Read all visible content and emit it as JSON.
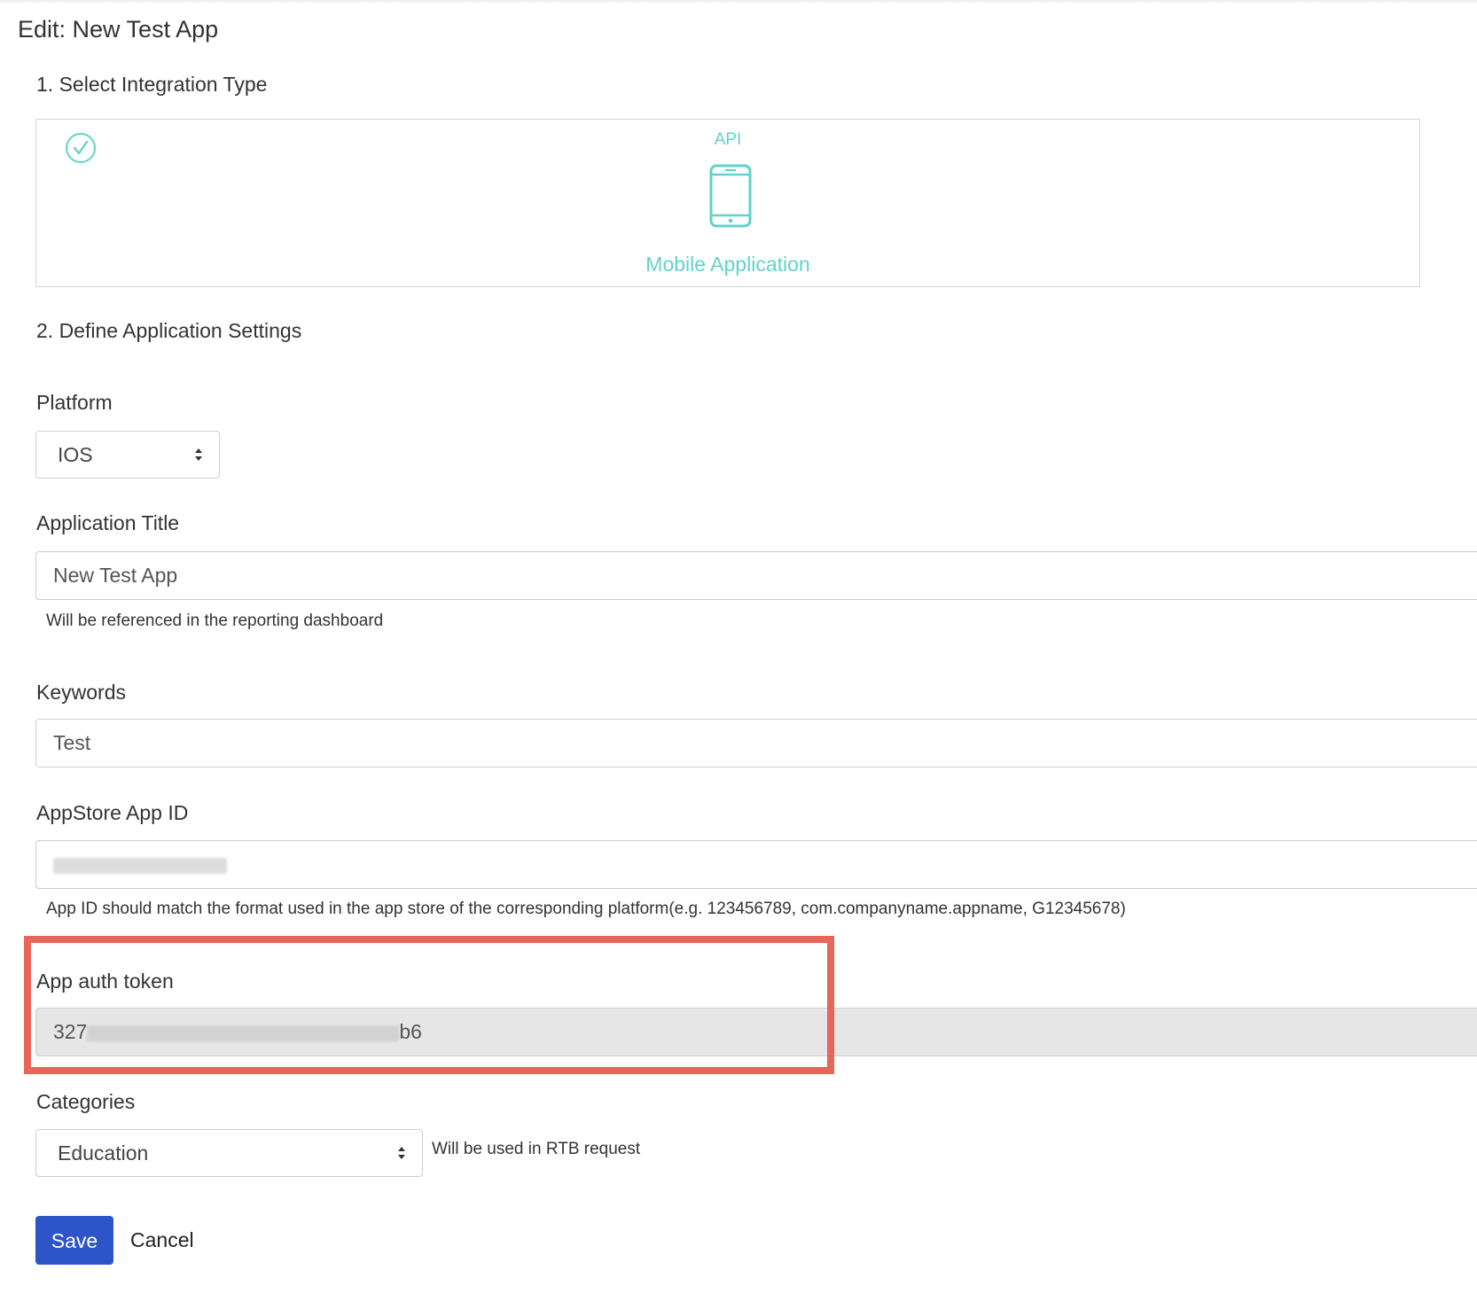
{
  "page": {
    "title": "Edit: New Test App"
  },
  "step1": {
    "heading": "1. Select Integration Type",
    "option": {
      "badge": "API",
      "title": "Mobile Application",
      "icon": "mobile-phone-icon",
      "selected_icon": "check-circle-icon",
      "accent_color": "#5fd3c9"
    }
  },
  "step2": {
    "heading": "2. Define Application Settings"
  },
  "platform": {
    "label": "Platform",
    "value": "IOS"
  },
  "app_title": {
    "label": "Application Title",
    "value": "New Test App",
    "help": "Will be referenced in the reporting dashboard"
  },
  "keywords": {
    "label": "Keywords",
    "value": "Test"
  },
  "appstore_id": {
    "label": "AppStore App ID",
    "help": "App ID should match the format used in the app store of the corresponding platform(e.g. 123456789, com.companyname.appname, G12345678)"
  },
  "auth_token": {
    "label": "App auth token",
    "value_prefix": "327",
    "value_suffix": "b6"
  },
  "categories": {
    "label": "Categories",
    "value": "Education",
    "help": "Will be used in RTB request"
  },
  "actions": {
    "save_label": "Save",
    "cancel_label": "Cancel"
  },
  "colors": {
    "primary_button": "#2d55c8",
    "highlight": "#e8655a"
  }
}
